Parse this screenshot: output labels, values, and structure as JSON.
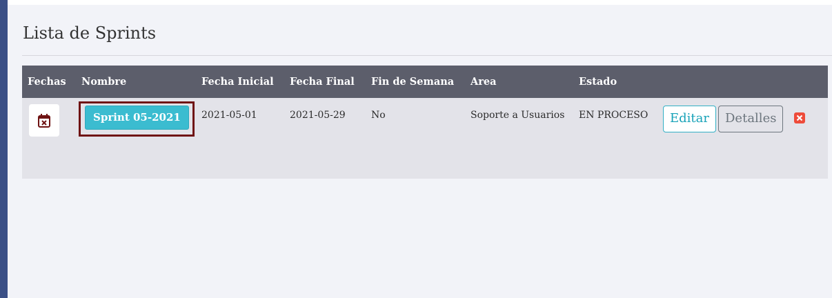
{
  "page": {
    "title": "Lista de Sprints"
  },
  "table": {
    "headers": [
      "Fechas",
      "Nombre",
      "Fecha Inicial",
      "Fecha Final",
      "Fin de Semana",
      "Area",
      "Estado",
      ""
    ],
    "rows": [
      {
        "nombre": "Sprint 05-2021",
        "fecha_inicial": "2021-05-01",
        "fecha_final": "2021-05-29",
        "fin_de_semana": "No",
        "area": "Soporte a Usuarios",
        "estado": "EN PROCESO",
        "actions": {
          "edit": "Editar",
          "details": "Detalles"
        }
      }
    ]
  },
  "icons": {
    "calendar": "calendar-x-icon",
    "delete": "close-icon"
  },
  "colors": {
    "header_bg": "#5c5e6b",
    "sprint_button": "#3bbcd0",
    "edit_border": "#31b0c5",
    "delete": "#ee4b3a",
    "highlight_frame": "#6f1313"
  }
}
